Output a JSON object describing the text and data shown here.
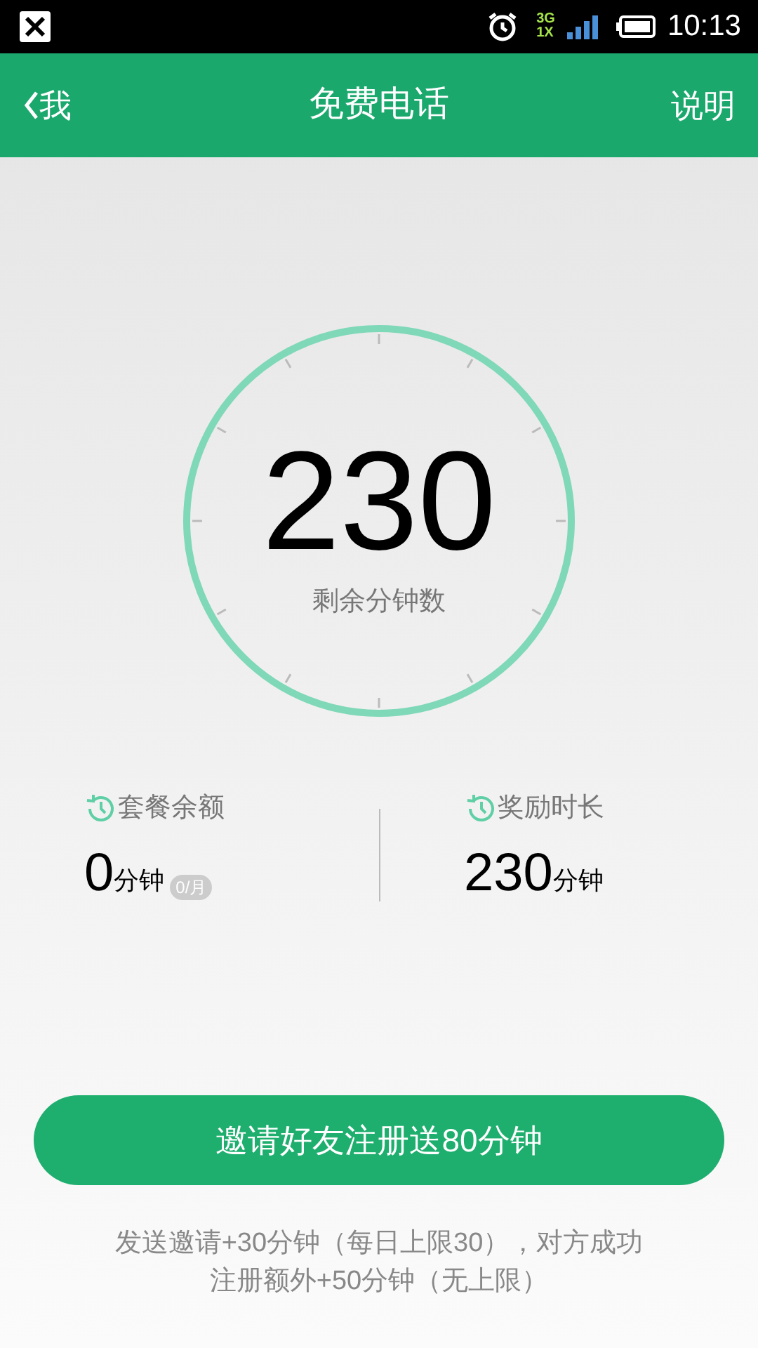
{
  "status_bar": {
    "time": "10:13",
    "network_top": "3G",
    "network_bottom": "1X"
  },
  "header": {
    "back": "我",
    "title": "免费电话",
    "action": "说明"
  },
  "dial": {
    "value": "230",
    "label": "剩余分钟数"
  },
  "stats": [
    {
      "label": "套餐余额",
      "value": "0",
      "unit": "分钟",
      "badge": "0/月"
    },
    {
      "label": "奖励时长",
      "value": "230",
      "unit": "分钟"
    }
  ],
  "invite_button": "邀请好友注册送80分钟",
  "note_lines": [
    "发送邀请+30分钟（每日上限30），对方成功",
    "注册额外+50分钟（无上限）"
  ]
}
